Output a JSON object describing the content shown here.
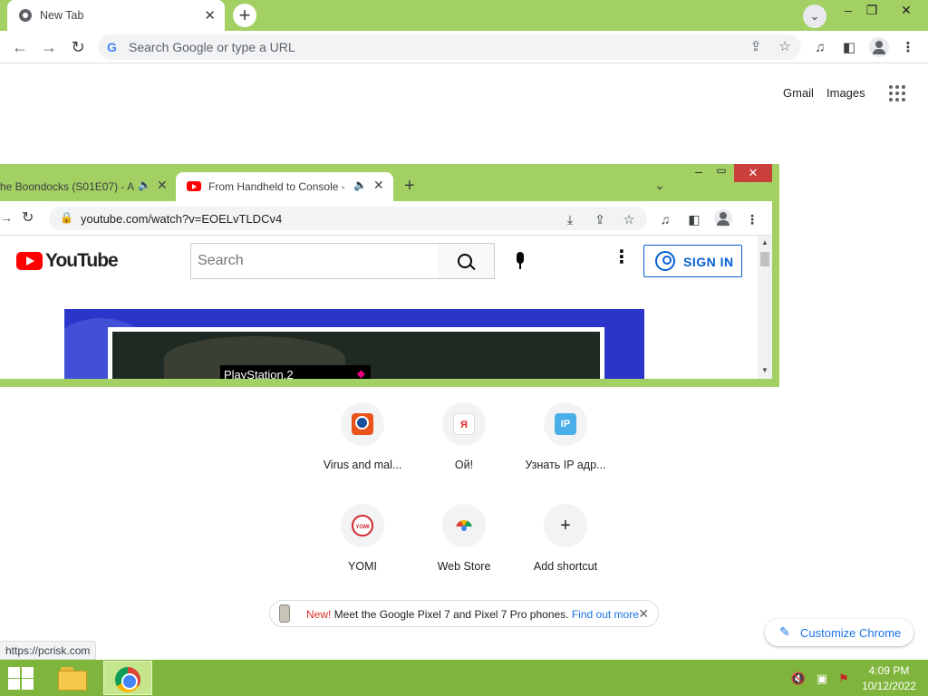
{
  "browser": {
    "tab": {
      "title": "New Tab"
    },
    "new_tab_label": "+",
    "omnibox_placeholder": "Search Google or type a URL",
    "window_controls": {
      "minimize": "–",
      "maximize": "❐",
      "close": "✕"
    }
  },
  "ntp": {
    "header_links": [
      "Gmail",
      "Images"
    ],
    "shortcuts": [
      {
        "label": "Virus and mal..."
      },
      {
        "label": "Ой!",
        "glyph": "Я"
      },
      {
        "label": "Узнать IP адр...",
        "glyph": "IP"
      },
      {
        "label": "YOMI",
        "glyph": "YOMI"
      },
      {
        "label": "Web Store"
      },
      {
        "label": "Add shortcut",
        "glyph": "+"
      }
    ],
    "promo": {
      "new": "New!",
      "text": " Meet the Google Pixel 7 and Pixel 7 Pro phones. ",
      "link": "Find out more"
    },
    "customize": "Customize Chrome",
    "status_url": "https://pcrisk.com"
  },
  "inner_browser": {
    "tabs": [
      {
        "title": "he Boondocks (S01E07) - A"
      },
      {
        "title": "From Handheld to Console -"
      }
    ],
    "url": "youtube.com/watch?v=EOELvTLDCv4",
    "youtube": {
      "logo_text": "YouTube",
      "search_placeholder": "Search",
      "sign_in": "SIGN IN",
      "video_overlay": "PlayStation.2"
    }
  },
  "taskbar": {
    "time": "4:09 PM",
    "date": "10/12/2022"
  },
  "colors": {
    "frame": "#a3d063",
    "taskbar": "#7fb53c",
    "accent": "#1a73e8"
  }
}
